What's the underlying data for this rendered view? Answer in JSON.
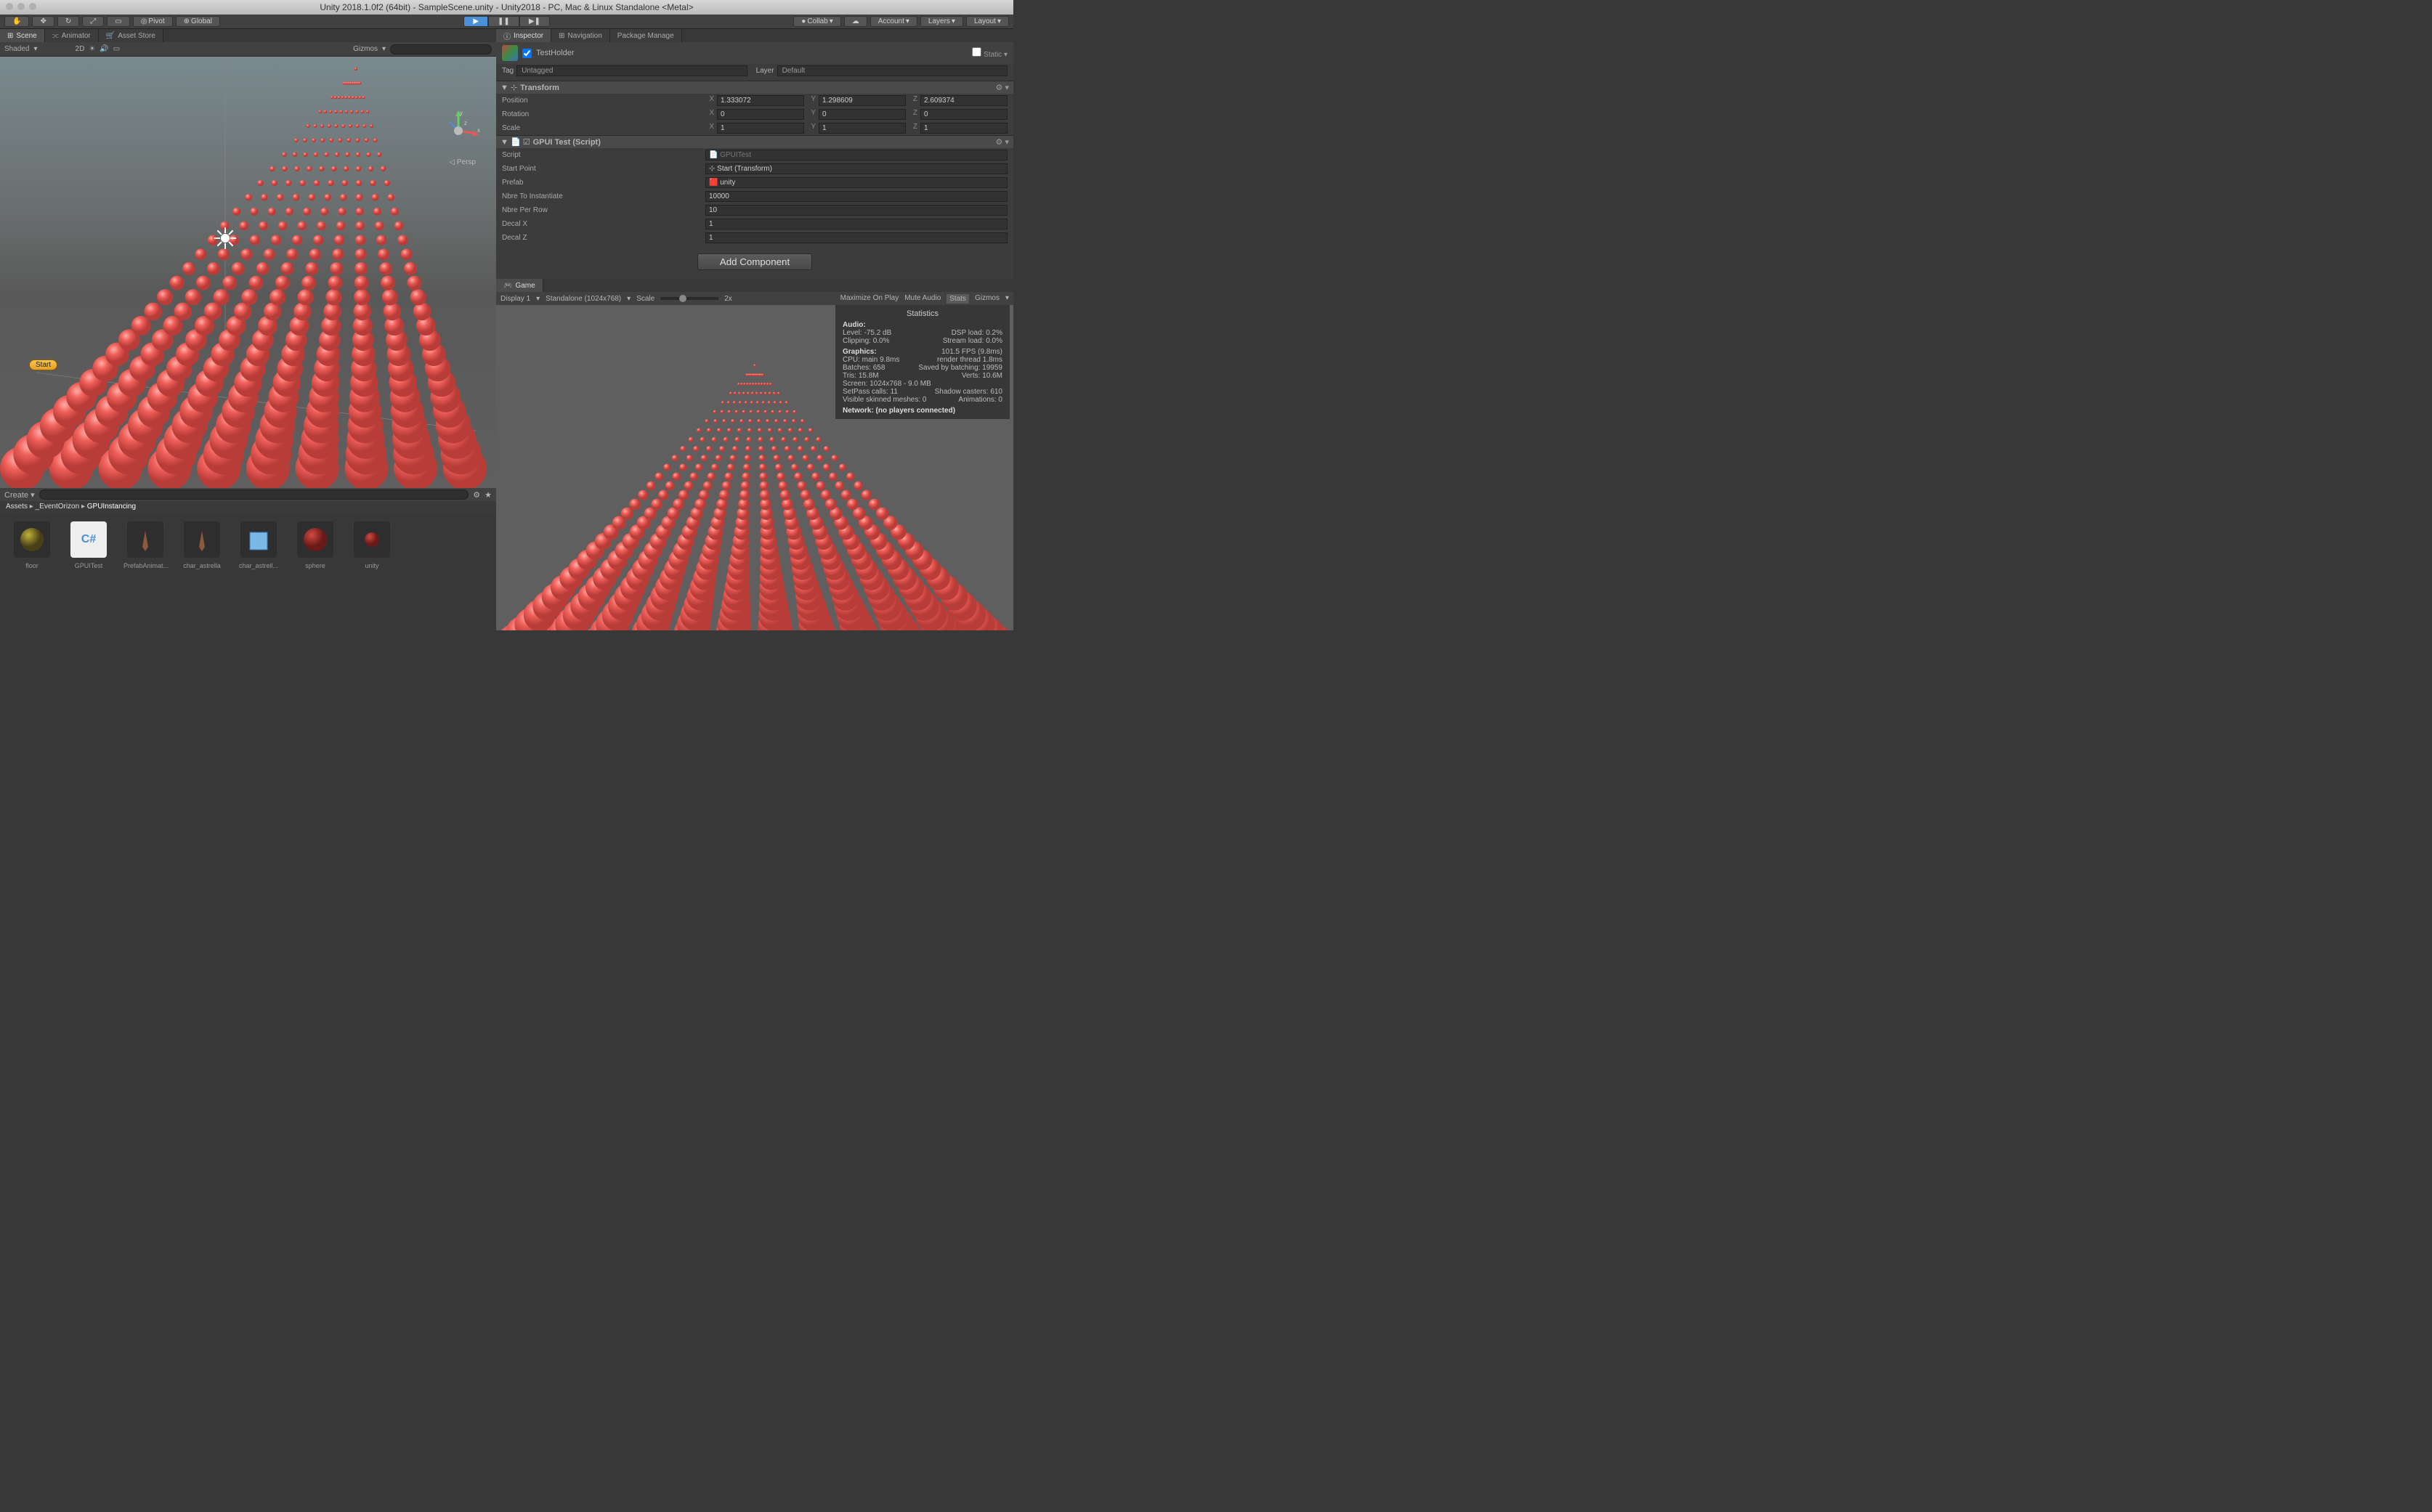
{
  "title": "Unity 2018.1.0f2 (64bit) - SampleScene.unity - Unity2018 - PC, Mac & Linux Standalone <Metal>",
  "toolbar": {
    "pivot": "Pivot",
    "global": "Global",
    "collab": "Collab",
    "account": "Account",
    "layers": "Layers",
    "layout": "Layout"
  },
  "tabs": {
    "scene": "Scene",
    "animator": "Animator",
    "assetstore": "Asset Store",
    "inspector": "Inspector",
    "navigation": "Navigation",
    "package": "Package Manage",
    "game": "Game"
  },
  "scenebar": {
    "shaded": "Shaded",
    "twod": "2D",
    "gizmos": "Gizmos"
  },
  "sceneoverlay": {
    "start": "Start",
    "persp": "Persp"
  },
  "inspector": {
    "name": "TestHolder",
    "static": "Static",
    "tag_label": "Tag",
    "tag_value": "Untagged",
    "layer_label": "Layer",
    "layer_value": "Default",
    "transform": {
      "title": "Transform",
      "position": {
        "label": "Position",
        "x": "1.333072",
        "y": "1.298609",
        "z": "2.609374"
      },
      "rotation": {
        "label": "Rotation",
        "x": "0",
        "y": "0",
        "z": "0"
      },
      "scale": {
        "label": "Scale",
        "x": "1",
        "y": "1",
        "z": "1"
      }
    },
    "gpui": {
      "title": "GPUI Test (Script)",
      "script_label": "Script",
      "script_value": "GPUITest",
      "start_point_label": "Start Point",
      "start_point_value": "Start (Transform)",
      "prefab_label": "Prefab",
      "prefab_value": "unity",
      "nbre_to_instantiate_label": "Nbre To Instantiate",
      "nbre_to_instantiate_value": "10000",
      "nbre_per_row_label": "Nbre Per Row",
      "nbre_per_row_value": "10",
      "decal_x_label": "Decal X",
      "decal_x_value": "1",
      "decal_z_label": "Decal Z",
      "decal_z_value": "1"
    },
    "add_component": "Add Component"
  },
  "gamebar": {
    "display": "Display 1",
    "resolution": "Standalone (1024x768)",
    "scale": "Scale",
    "zoom": "2x",
    "maximize": "Maximize On Play",
    "mute": "Mute Audio",
    "stats": "Stats",
    "gizmos": "Gizmos"
  },
  "stats": {
    "title": "Statistics",
    "audio_label": "Audio:",
    "level": "Level: -75.2 dB",
    "dsp": "DSP load: 0.2%",
    "clipping": "Clipping: 0.0%",
    "stream": "Stream load: 0.0%",
    "graphics_label": "Graphics:",
    "fps": "101.5 FPS (9.8ms)",
    "cpu": "CPU: main 9.8ms",
    "render": "render thread 1.8ms",
    "batches": "Batches: 658",
    "saved": "Saved by batching: 19959",
    "tris": "Tris: 15.8M",
    "verts": "Verts: 10.6M",
    "screen": "Screen: 1024x768 - 9.0 MB",
    "setpass": "SetPass calls: 11",
    "shadow": "Shadow casters: 610",
    "skinned": "Visible skinned meshes: 0",
    "anim": "Animations: 0",
    "network": "Network: (no players connected)"
  },
  "project": {
    "crumb_assets": "Assets",
    "crumb_eventorizon": "_EventOrizon",
    "crumb_gpu": "GPUInstancing",
    "items": [
      {
        "name": "floor"
      },
      {
        "name": "GPUITest"
      },
      {
        "name": "PrefabAnimat..."
      },
      {
        "name": "char_astrella"
      },
      {
        "name": "char_astrell..."
      },
      {
        "name": "sphere"
      },
      {
        "name": "unity"
      }
    ]
  }
}
